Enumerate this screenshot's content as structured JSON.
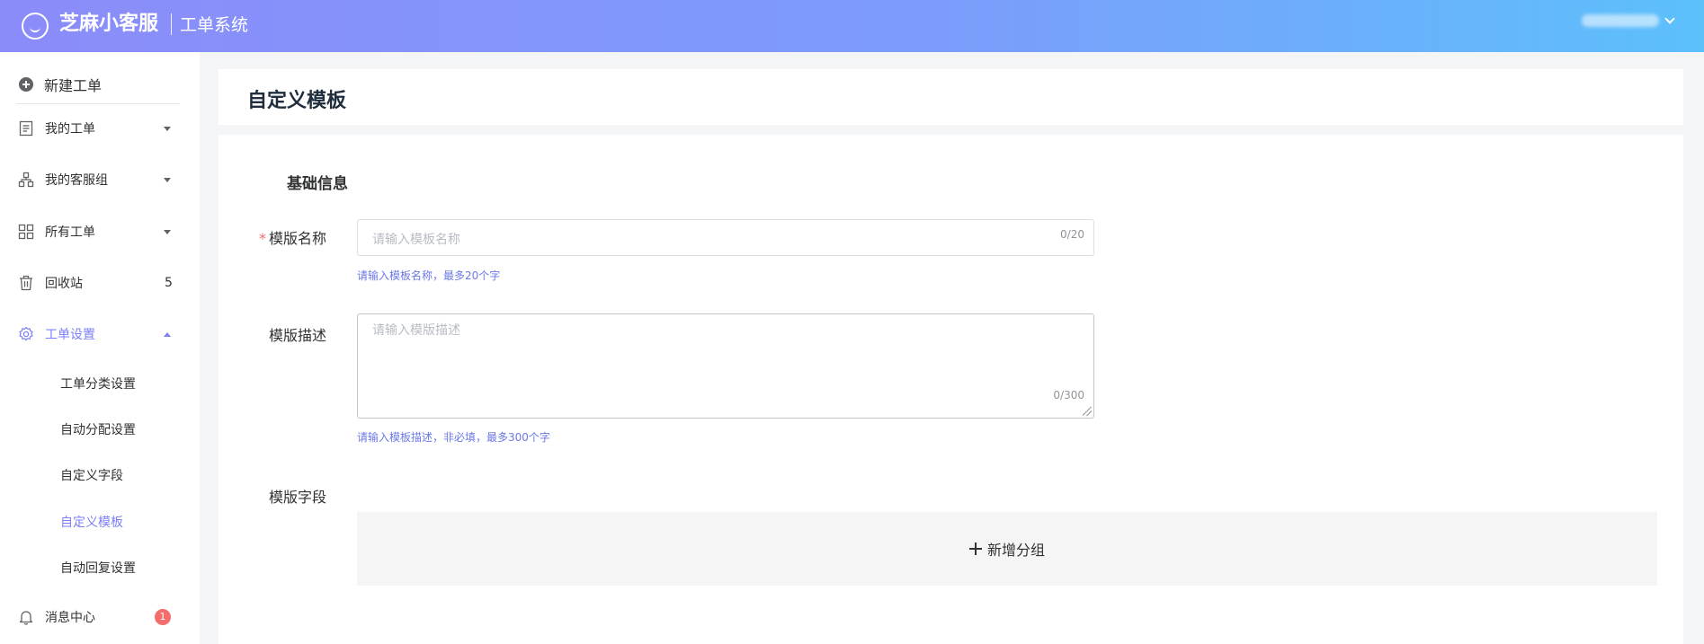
{
  "header": {
    "brand": "芝麻小客服",
    "system": "工单系统"
  },
  "sidebar": {
    "new_ticket": "新建工单",
    "items": [
      {
        "label": "我的工单",
        "icon": "document-icon"
      },
      {
        "label": "我的客服组",
        "icon": "group-icon"
      },
      {
        "label": "所有工单",
        "icon": "grid-icon"
      },
      {
        "label": "回收站",
        "icon": "trash-icon",
        "count": "5"
      },
      {
        "label": "工单设置",
        "icon": "gear-icon"
      }
    ],
    "settings_sub": [
      "工单分类设置",
      "自动分配设置",
      "自定义字段",
      "自定义模板",
      "自动回复设置"
    ],
    "message_center": {
      "label": "消息中心",
      "badge": "1"
    }
  },
  "main": {
    "page_title": "自定义模板",
    "section_title": "基础信息",
    "name_field": {
      "label": "模版名称",
      "placeholder": "请输入模板名称",
      "count": "0/20",
      "hint": "请输入模板名称，最多20个字"
    },
    "desc_field": {
      "label": "模版描述",
      "placeholder": "请输入模版描述",
      "count": "0/300",
      "hint": "请输入模板描述，非必填，最多300个字"
    },
    "fields_label": "模版字段",
    "add_group": "新增分组"
  },
  "colors": {
    "accent": "#7c7ff7",
    "header_start": "#8b8cf9",
    "header_end": "#5cc0fb",
    "badge": "#f56c6c"
  }
}
